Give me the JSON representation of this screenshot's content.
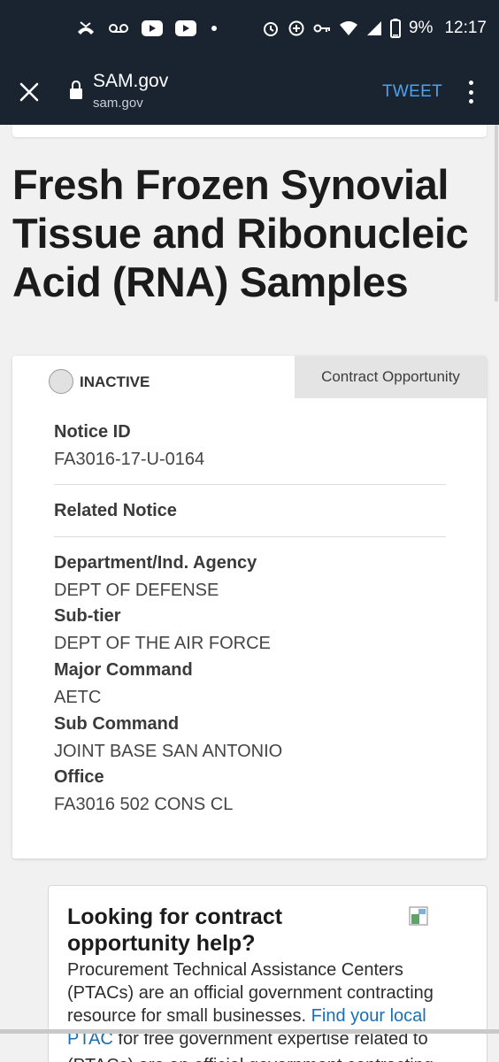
{
  "status_bar": {
    "time": "12:17",
    "battery": "9%",
    "left_icons": [
      "missed-call-icon",
      "voicemail-icon",
      "youtube-icon",
      "youtube-icon",
      "dot-icon"
    ],
    "right_icons": [
      "alarm-icon",
      "data-saver-icon",
      "vpn-key-icon",
      "wifi-icon",
      "cell-signal-icon",
      "battery-icon"
    ]
  },
  "browser": {
    "title": "SAM.gov",
    "url": "sam.gov",
    "action": "TWEET"
  },
  "page": {
    "title": "Fresh Frozen Synovial Tissue and Ribonucleic Acid (RNA) Samples"
  },
  "card": {
    "status": "INACTIVE",
    "type": "Contract Opportunity",
    "notice_id_label": "Notice ID",
    "notice_id_value": "FA3016-17-U-0164",
    "related_notice_label": "Related Notice",
    "department_label": "Department/Ind. Agency",
    "department_value": "DEPT OF DEFENSE",
    "subtier_label": "Sub-tier",
    "subtier_value": "DEPT OF THE AIR FORCE",
    "major_command_label": "Major Command",
    "major_command_value": "AETC",
    "sub_command_label": "Sub Command",
    "sub_command_value": "JOINT BASE SAN ANTONIO",
    "office_label": "Office",
    "office_value": "FA3016 502 CONS CL"
  },
  "help": {
    "title": "Looking for contract opportunity help?",
    "text_before_link": "Procurement Technical Assistance Centers (PTACs) are an official government contracting resource for small businesses. ",
    "link_text": "Find your local PTAC",
    "text_after_link": " for free government expertise related to",
    "trailing_text": "(PTACs) are an official government contracting"
  },
  "colors": {
    "chrome_bg": "#1a2430",
    "tweet": "#4aa3f0",
    "link": "#1a6fb3",
    "page_bg": "#f1f1f1"
  }
}
